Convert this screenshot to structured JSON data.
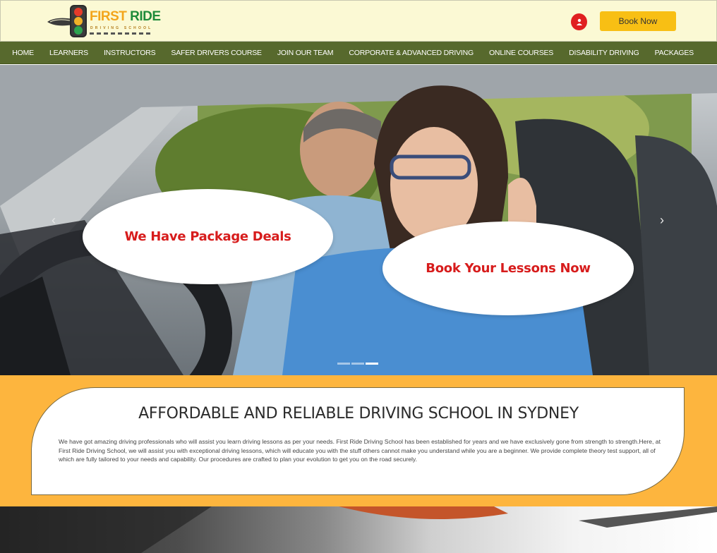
{
  "header": {
    "logo": {
      "brand_first": "FIRST",
      "brand_second": "RIDE",
      "tagline": "DRIVING SCHOOL"
    },
    "book_label": "Book Now",
    "user_icon": "user-icon"
  },
  "nav": {
    "items": [
      "HOME",
      "LEARNERS",
      "INSTRUCTORS",
      "SAFER DRIVERS COURSE",
      "JOIN OUR TEAM",
      "CORPORATE & ADVANCED DRIVING",
      "ONLINE COURSES",
      "DISABILITY DRIVING",
      "PACKAGES"
    ]
  },
  "hero": {
    "bubble_left": "We Have Package Deals",
    "bubble_right": "Book Your Lessons Now",
    "prev_glyph": "‹",
    "next_glyph": "›",
    "slide_count": 3,
    "active_slide": 3
  },
  "about": {
    "title": "AFFORDABLE AND RELIABLE DRIVING SCHOOL IN SYDNEY",
    "body": "We have got amazing driving professionals who will assist you learn driving lessons as per your needs. First Ride Driving School has been established for years and we have exclusively gone from strength to strength.Here, at First Ride Driving School, we will assist you with exceptional driving lessons, which will educate you with the stuff others cannot make you understand while you are a beginner. We provide complete theory test support, all of which are fully tailored to your needs and capability. Our procedures are crafted to plan your evolution to get you on the road securely."
  },
  "colors": {
    "header_bg": "#fbf9d4",
    "nav_bg": "#57692d",
    "accent_yellow": "#f8bf14",
    "section_orange": "#fdb53e",
    "bubble_text_red": "#d71c1c"
  }
}
